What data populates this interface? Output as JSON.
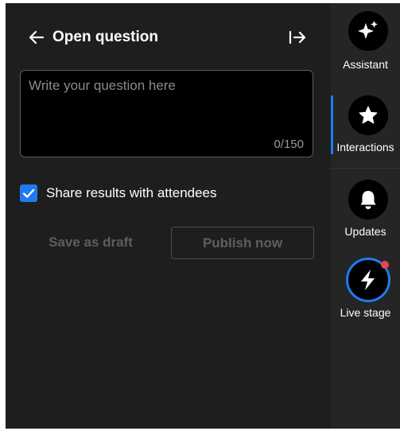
{
  "header": {
    "title": "Open question",
    "back_icon": "arrow-left-icon",
    "collapse_icon": "collapse-right-icon"
  },
  "question": {
    "placeholder": "Write your question here",
    "value": "",
    "counter": "0/150"
  },
  "share": {
    "label": "Share results with attendees",
    "checked": true
  },
  "actions": {
    "draft_label": "Save as draft",
    "publish_label": "Publish now"
  },
  "rail": {
    "items": [
      {
        "label": "Assistant",
        "icon": "sparkle-icon"
      },
      {
        "label": "Interactions",
        "icon": "star-icon",
        "active": true
      },
      {
        "label": "Updates",
        "icon": "bell-icon"
      },
      {
        "label": "Live stage",
        "icon": "lightning-icon",
        "has_notification": true
      }
    ]
  },
  "colors": {
    "panel_bg": "#1e1e1e",
    "rail_bg": "#252525",
    "accent": "#1f7bf2",
    "notification": "#e8444d",
    "disabled_text": "#5e5e5e"
  }
}
